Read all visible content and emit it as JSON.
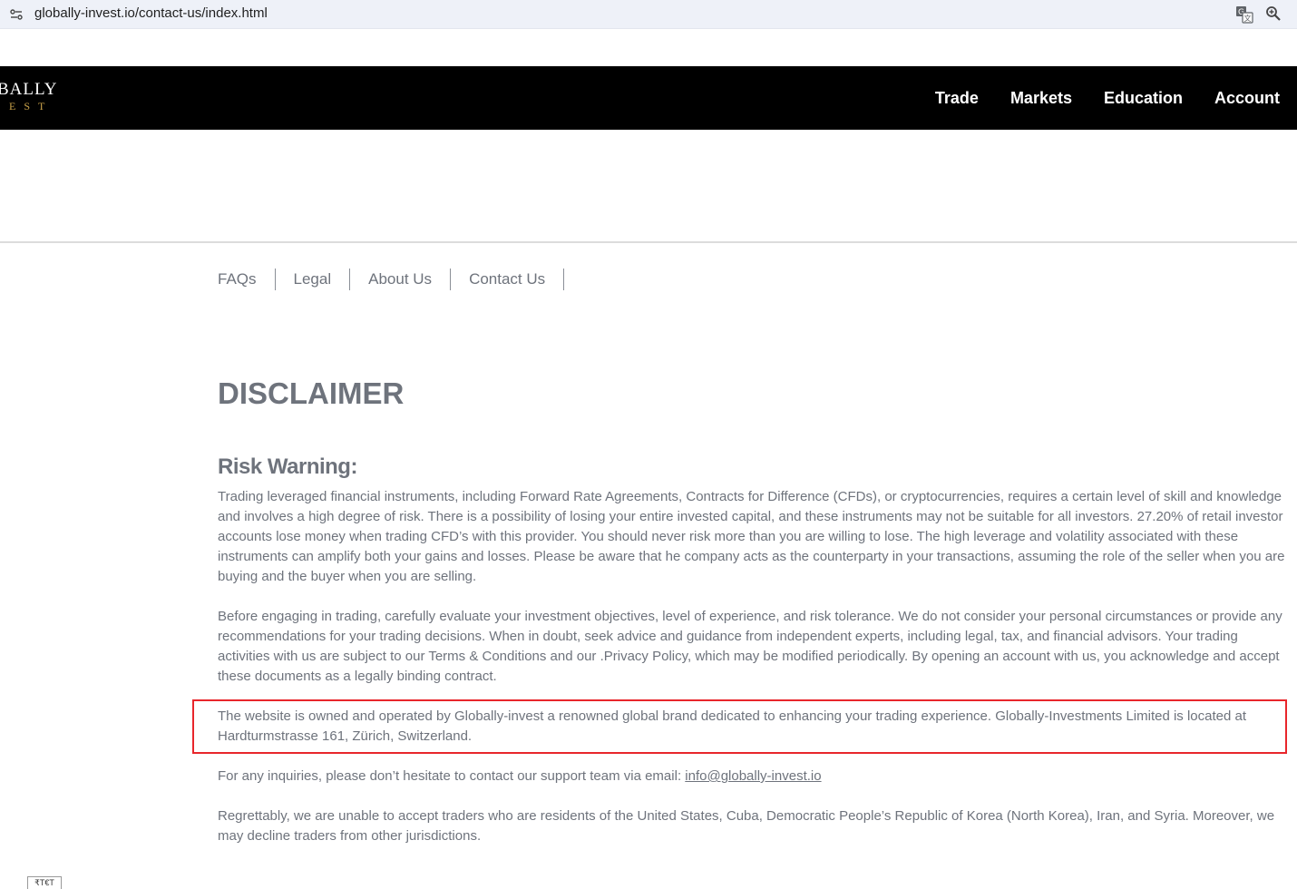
{
  "browser": {
    "url": "globally-invest.io/contact-us/index.html",
    "icons": [
      "site-info-icon",
      "translate-icon",
      "zoom-icon"
    ]
  },
  "header": {
    "logo_top": "BALLY",
    "logo_bottom": "EST",
    "nav": [
      "Trade",
      "Markets",
      "Education",
      "Account"
    ]
  },
  "subnav": [
    "FAQs",
    "Legal",
    "About Us",
    "Contact Us"
  ],
  "page": {
    "title": "DISCLAIMER",
    "section_title": "Risk Warning:",
    "paragraphs": [
      "Trading leveraged financial instruments, including Forward Rate Agreements, Contracts for Difference (CFDs), or cryptocurrencies, requires a certain level of skill and knowledge and involves a high degree of risk. There is a possibility of losing your entire invested capital, and these instruments may not be suitable for all investors. 27.20% of retail investor accounts lose money when trading CFD’s with this provider. You should never risk more than you are willing to lose. The high leverage and volatility associated with these instruments can amplify both your gains and losses. Please be aware that he company acts as the counterparty in your transactions, assuming the role of the seller when you are buying and the buyer when you are selling.",
      "Before engaging in trading, carefully evaluate your investment objectives, level of experience, and risk tolerance. We do not consider your personal circumstances or provide any recommendations for your trading decisions. When in doubt, seek advice and guidance from independent experts, including legal, tax, and financial advisors. Your trading activities with us are subject to our Terms & Conditions and our .Privacy Policy, which may be modified periodically. By opening an account with us, you acknowledge and accept these documents as a legally binding contract.",
      "The website is owned and operated by Globally-invest a renowned global brand dedicated to enhancing your trading experience. Globally-Investments Limited is located at Hardturmstrasse 161, Zürich, Switzerland."
    ],
    "inquiry_text": "For any inquiries, please don’t hesitate to contact our support team via email: ",
    "email": "info@globally-invest.io",
    "restriction_text": "Regrettably, we are unable to accept traders who are residents of the United States, Cuba, Democratic People’s Republic of Korea (North Korea), Iran, and Syria. Moreover, we may decline traders from other jurisdictions."
  },
  "corner_widget": "₹T€T",
  "colors": {
    "header_bg": "#000000",
    "text_gray": "#6e737c",
    "logo_gold": "#c9a24a",
    "highlight_red": "#e8262b"
  }
}
